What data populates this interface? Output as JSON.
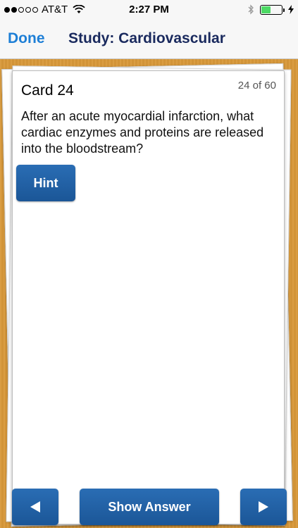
{
  "status_bar": {
    "carrier": "AT&T",
    "time": "2:27 PM",
    "signal_bars_filled": 2,
    "signal_bars_total": 5,
    "battery_level": 0.45
  },
  "nav": {
    "done_label": "Done",
    "title": "Study: Cardiovascular"
  },
  "card": {
    "title": "Card 24",
    "counter": "24 of 60",
    "question": "After an acute myocardial infarction, what cardiac enzymes and proteins are released into the bloodstream?"
  },
  "buttons": {
    "hint_label": "Hint",
    "show_answer_label": "Show Answer",
    "prev_icon": "triangle-left-icon",
    "next_icon": "triangle-right-icon"
  },
  "colors": {
    "button_blue": "#1f5fa3",
    "done_blue": "#1e7fd6",
    "title_navy": "#1a2a5e",
    "background_wood": "#d9993a",
    "battery_green": "#4cd964"
  }
}
